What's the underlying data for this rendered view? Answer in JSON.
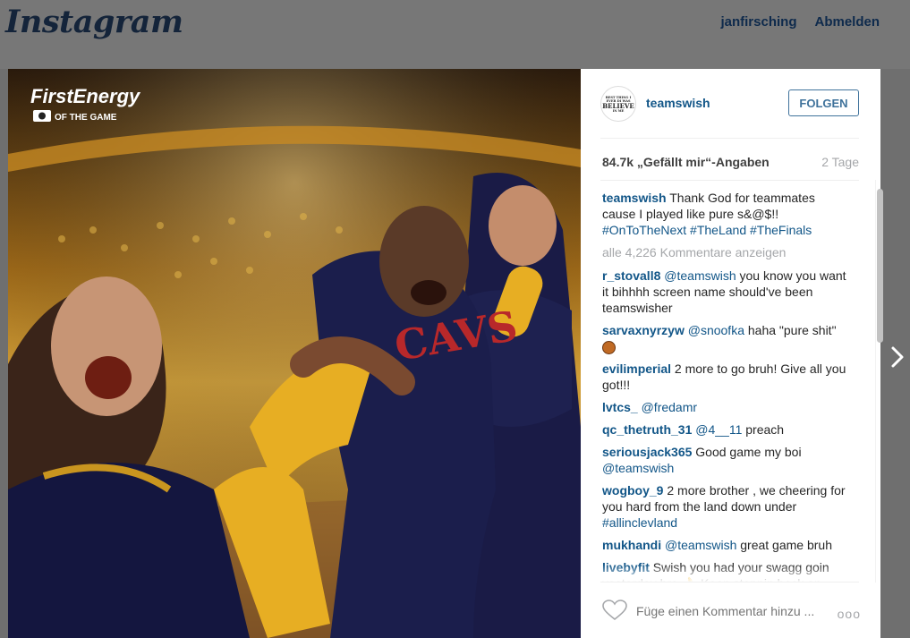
{
  "header": {
    "logo_text": "Instagram",
    "user_link": "janfirsching",
    "logout_link": "Abmelden"
  },
  "photo": {
    "brand_title": "FirstEnergy",
    "brand_subtitle": "OF THE GAME",
    "jersey_text": "CAVS",
    "icons": [
      "camera-icon"
    ]
  },
  "post": {
    "author": "teamswish",
    "avatar_lines": [
      "BEST THING I EVER DI WAS",
      "BELIEVE",
      "IN ME"
    ],
    "follow_label": "FOLGEN",
    "likes": "84.7k „Gefällt mir“-Angaben",
    "time": "2 Tage",
    "caption": {
      "user": "teamswish",
      "text": "Thank God for teammates cause I played like pure s&@$!!",
      "hashtags": "#OnToTheNext #TheLand #TheFinals"
    },
    "view_all": "alle 4,226 Kommentare anzeigen",
    "comments": [
      {
        "user": "r_stovall8",
        "mention": "@teamswish",
        "text": " you know you want it bihhhh screen name should've been teamswisher"
      },
      {
        "user": "sarvaxnyrzyw",
        "mention": "@snoofka",
        "text": " haha \"pure shit\"",
        "emoji": "basketball-emoji"
      },
      {
        "user": "evilimperial",
        "mention": "",
        "text": " 2 more to go bruh! Give all you got!!!"
      },
      {
        "user": "lvtcs_",
        "mention": "@fredamr",
        "text": ""
      },
      {
        "user": "qc_thetruth_31",
        "mention": "@4__11",
        "text": " preach"
      },
      {
        "user": "seriousjack365",
        "mention": "",
        "text": " Good game my boi ",
        "mention2": "@teamswish"
      },
      {
        "user": "wogboy_9",
        "mention": "",
        "text": " 2 more brother , we cheering for you hard from the land down under ",
        "mention2": "#allinclevland"
      },
      {
        "user": "mukhandi",
        "mention": "@teamswish",
        "text": " great game bruh"
      },
      {
        "user": "livebyfit",
        "mention": "",
        "text": " Swish you had your swagg goin yesterday bro 👌 Keep steppin back an"
      }
    ],
    "comment_placeholder": "Füge einen Kommentar hinzu ...",
    "more_options": "ooo"
  },
  "colors": {
    "link_blue": "#125688",
    "follow_blue": "#3f729b",
    "gray_text": "#a5a7aa",
    "overlay": "#777777"
  }
}
